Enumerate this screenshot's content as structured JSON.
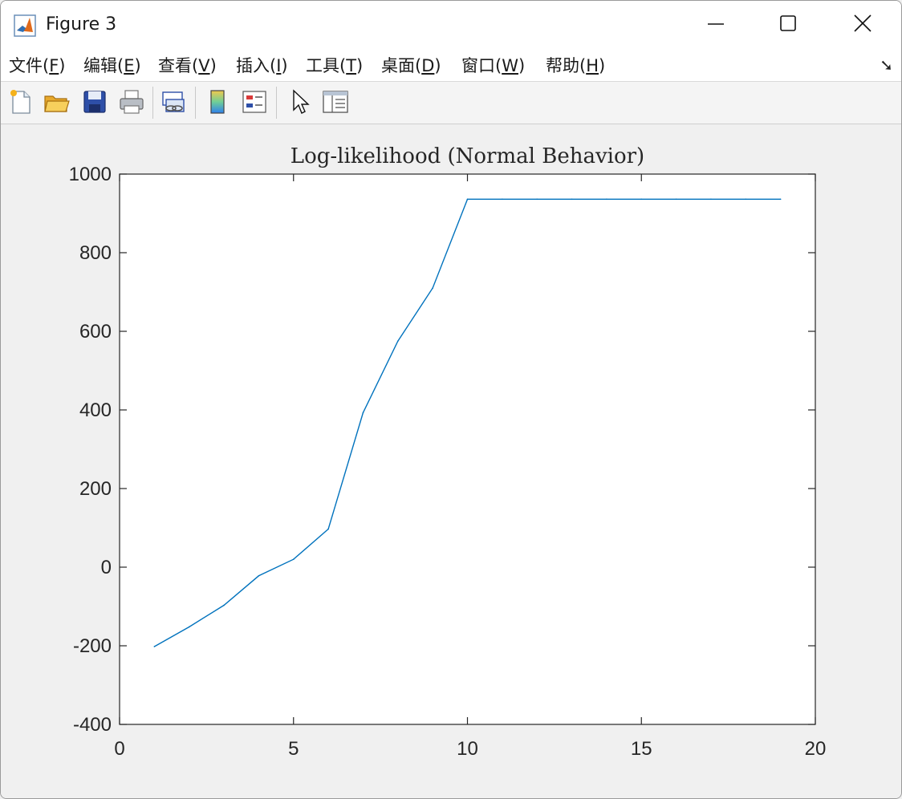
{
  "window": {
    "title": "Figure 3",
    "icon": "matlab-logo-icon"
  },
  "menu": {
    "items": [
      {
        "label": "文件(",
        "key": "F",
        "end": ")"
      },
      {
        "label": "编辑(",
        "key": "E",
        "end": ")"
      },
      {
        "label": "查看(",
        "key": "V",
        "end": ")"
      },
      {
        "label": "插入(",
        "key": "I",
        "end": ")"
      },
      {
        "label": "工具(",
        "key": "T",
        "end": ")"
      },
      {
        "label": "桌面(",
        "key": "D",
        "end": ")"
      },
      {
        "label": "窗口(",
        "key": "W",
        "end": ")"
      },
      {
        "label": "帮助(",
        "key": "H",
        "end": ")"
      }
    ]
  },
  "toolbar": {
    "buttons": [
      "new-figure-icon",
      "open-file-icon",
      "save-icon",
      "print-icon",
      "link-plot-icon",
      "colorbar-icon",
      "legend-icon",
      "pointer-icon",
      "property-inspector-icon"
    ]
  },
  "chart_data": {
    "type": "line",
    "title": "Log-likelihood (Normal Behavior)",
    "xlabel": "",
    "ylabel": "",
    "xlim": [
      0,
      20
    ],
    "ylim": [
      -400,
      1000
    ],
    "xticks": [
      0,
      5,
      10,
      15,
      20
    ],
    "yticks": [
      -400,
      -200,
      0,
      200,
      400,
      600,
      800,
      1000
    ],
    "series": [
      {
        "color": "#0072bd",
        "x": [
          1,
          2,
          3,
          4,
          5,
          6,
          7,
          8,
          9,
          10,
          11,
          12,
          13,
          14,
          15,
          16,
          17,
          18,
          19
        ],
        "y": [
          -202,
          -152,
          -97,
          -22,
          20,
          97,
          393,
          575,
          710,
          936,
          936,
          936,
          936,
          936,
          936,
          936,
          936,
          936,
          936
        ]
      }
    ],
    "grid": false,
    "legend": "none"
  }
}
